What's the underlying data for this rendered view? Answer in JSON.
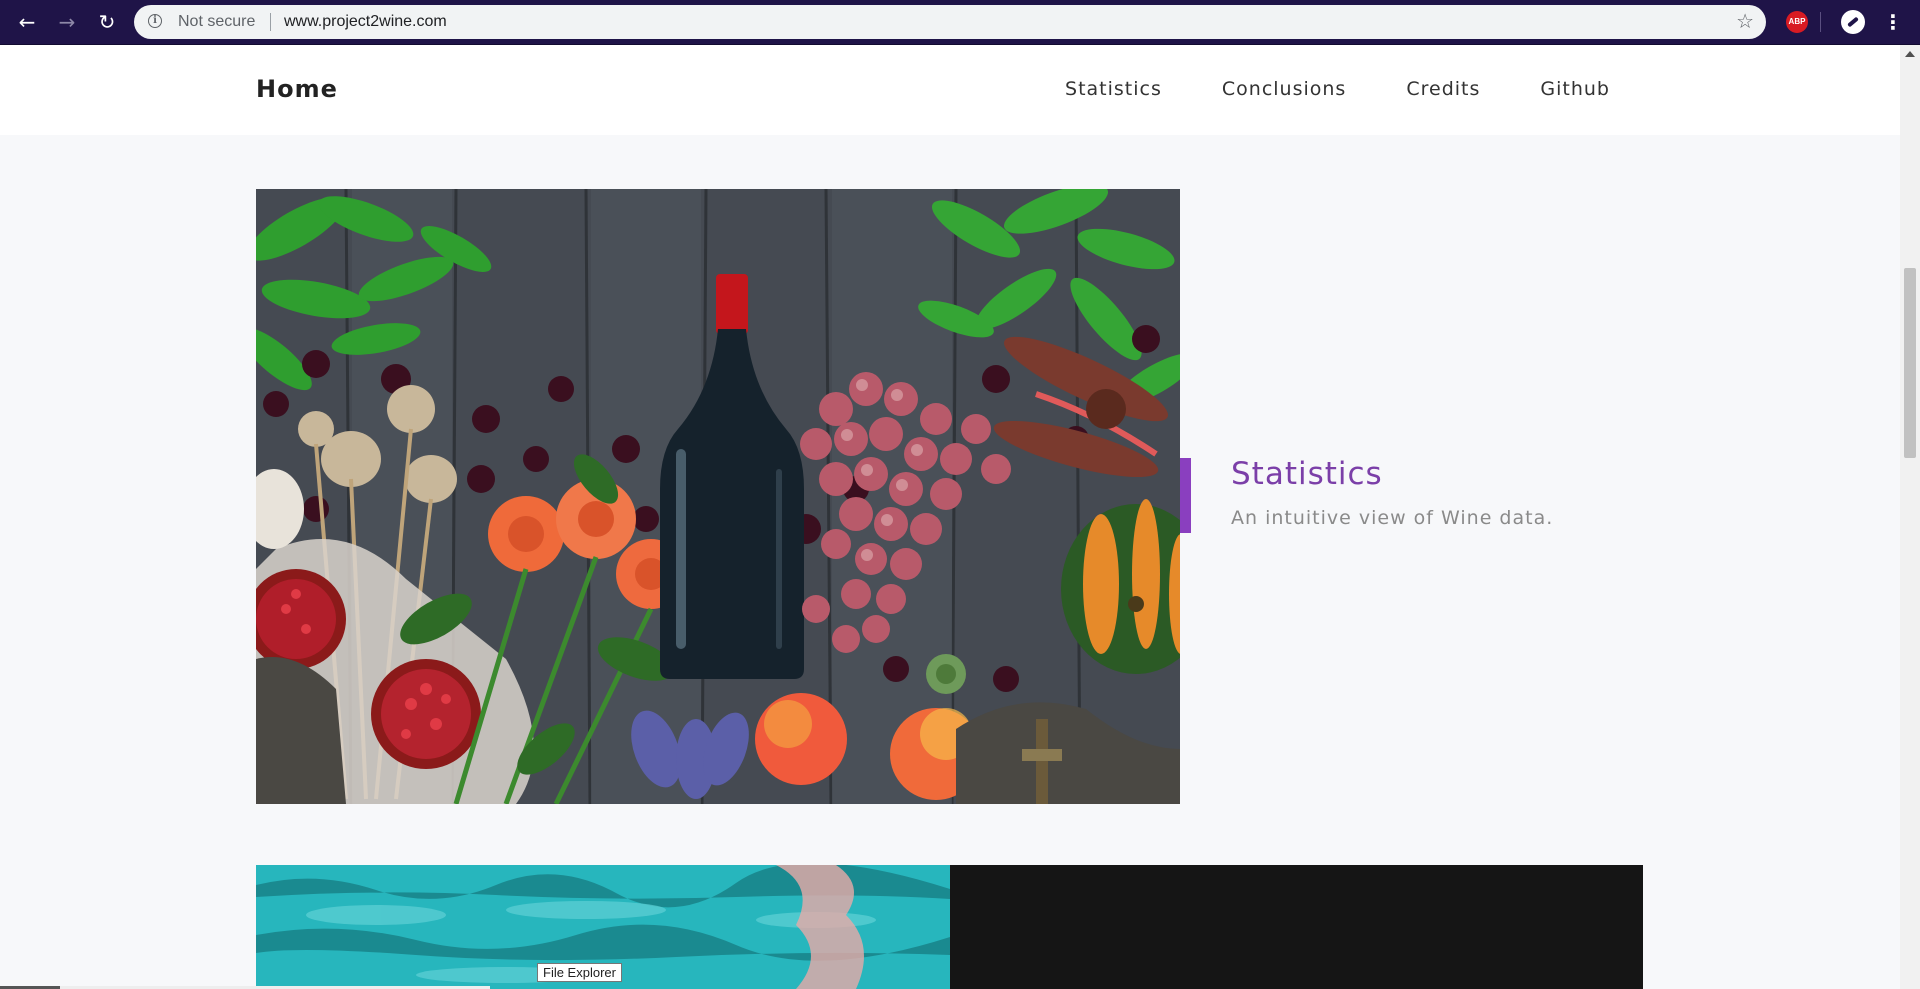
{
  "browser": {
    "back_icon": "arrow-left-icon",
    "forward_icon": "arrow-right-icon",
    "reload_icon": "reload-icon",
    "security_label": "Not secure",
    "url": "www.project2wine.com",
    "bookmark_icon": "star-icon",
    "extensions": [
      {
        "name": "adblock-plus-icon",
        "label": "ABP"
      },
      {
        "name": "compass-extension-icon",
        "label": ""
      }
    ],
    "menu_icon": "kebab-menu-icon"
  },
  "navbar": {
    "brand": "Home",
    "links": [
      "Statistics",
      "Conclusions",
      "Credits",
      "Github"
    ]
  },
  "feature": {
    "title": "Statistics",
    "subtitle": "An intuitive view of Wine data.",
    "image": "wine-bottle-fruit-still-life",
    "accent_color": "#8a3fbf"
  },
  "section2": {
    "image": "pool-water-reflection",
    "panel_color": "#151515"
  },
  "tooltip": {
    "text": "File Explorer"
  },
  "colors": {
    "chrome_bg": "#1f1448",
    "page_bg": "#f7f8fa",
    "title_color": "#7b3fa8"
  }
}
